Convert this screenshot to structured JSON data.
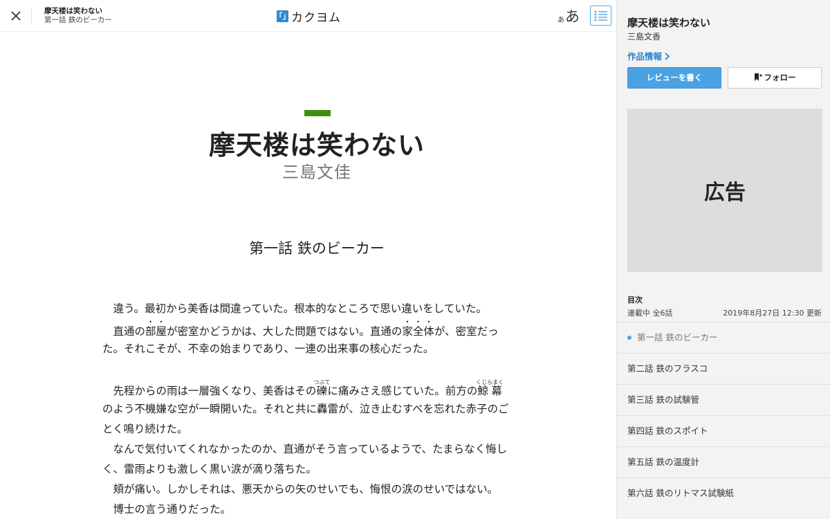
{
  "header": {
    "work_title": "摩天楼は笑わない",
    "episode_title": "第一話 鉄のビーカー",
    "logo_mark": "「」",
    "logo_text": "カクヨム",
    "font_small": "あ",
    "font_large": "あ",
    "icons": {
      "close": "close-icon",
      "toc": "list-icon"
    }
  },
  "main": {
    "work_title": "摩天楼は笑わない",
    "author": "三島文佳",
    "episode_title": "第一話 鉄のビーカー",
    "accent_color": "#3f8f0f",
    "paragraphs": {
      "p1": "　違う。最初から美香は間違っていた。根本的なところで思い違いをしていた。",
      "p2_pre": "　直通の",
      "p2_em": "部屋",
      "p2_post": "が密室かどうかは、大した問題ではない。直通の",
      "p2_em2": "家全体",
      "p2_post2": "が、密室だっ",
      "p3": "た。それこそが、不幸の始まりであり、一連の出来事の核心だった。",
      "p4_pre": "　先程からの雨は一層強くなり、美香はその",
      "p4_ruby1_base": "礫",
      "p4_ruby1_text": "つぶて",
      "p4_mid": "に痛みさえ感じていた。前方の",
      "p4_ruby2_base": "鯨幕",
      "p4_ruby2_text": "くじらまく",
      "p5": "のよう不機嫌な空が一瞬開いた。それと共に轟雷が、泣き止むすべを忘れた赤子のご",
      "p6": "とく鳴り続けた。",
      "p7": "　なんで気付いてくれなかったのか、直通がそう言っているようで、たまらなく悔し",
      "p8": "く、雷雨よりも激しく黒い涙が滴り落ちた。",
      "p9": "　頬が痛い。しかしそれは、悪天からの矢のせいでも、悔恨の涙のせいではない。",
      "p10": "　博士の言う通りだった。"
    }
  },
  "sidebar": {
    "work_title": "摩天楼は笑わない",
    "author": "三島文香",
    "info_link": "作品情報",
    "review_button": "レビューを書く",
    "follow_button": "フォロー",
    "ad_label": "広告",
    "toc_heading": "目次",
    "status": "連載中 全6話",
    "updated": "2019年8月27日 12:30 更新",
    "accent_color": "#4aa2e3",
    "episodes": [
      {
        "label": "第一話 鉄のビーカー",
        "current": true
      },
      {
        "label": "第二話 鉄のフラスコ",
        "current": false
      },
      {
        "label": "第三話 鉄の試験管",
        "current": false
      },
      {
        "label": "第四話 鉄のスポイト",
        "current": false
      },
      {
        "label": "第五話 鉄の温度計",
        "current": false
      },
      {
        "label": "第六話 鉄のリトマス試験紙",
        "current": false
      }
    ]
  }
}
